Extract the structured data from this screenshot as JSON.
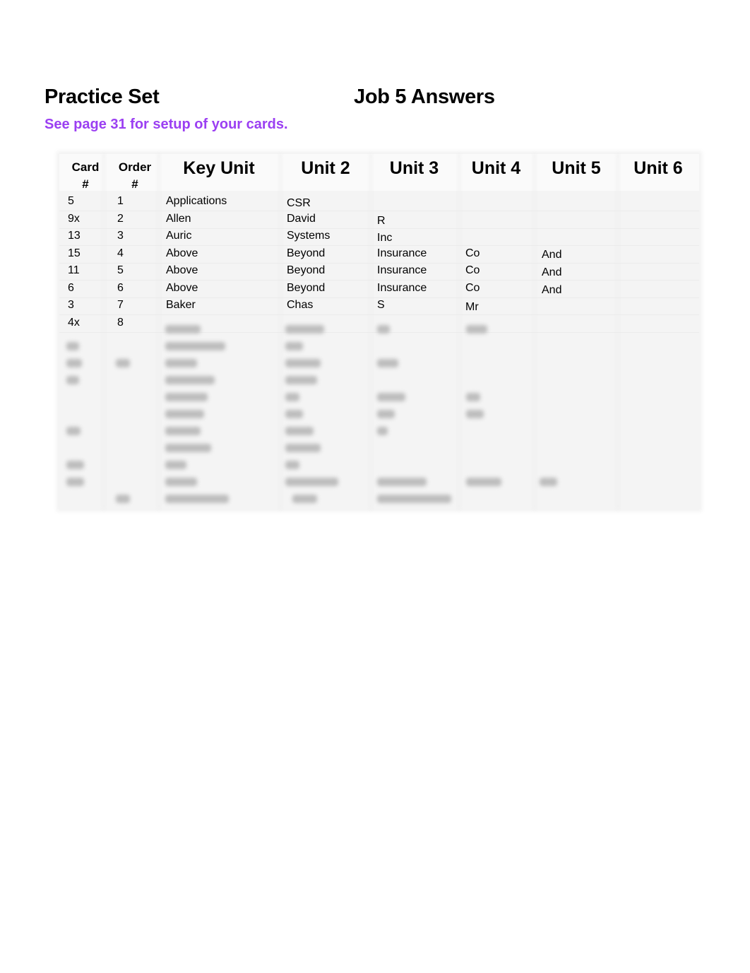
{
  "header": {
    "title": "Practice Set",
    "job_title": "Job 5 Answers",
    "subtitle": "See page 31 for setup of your cards.",
    "subtitle_color": "#9b3ff2"
  },
  "table": {
    "columns": [
      {
        "line1": "Card",
        "line2": "#"
      },
      {
        "line1": "Order",
        "line2": "#"
      },
      {
        "line1": "Key Unit"
      },
      {
        "line1": "Unit 2"
      },
      {
        "line1": "Unit 3"
      },
      {
        "line1": "Unit 4"
      },
      {
        "line1": "Unit 5"
      },
      {
        "line1": "Unit 6"
      }
    ],
    "rows": [
      [
        "5",
        "1",
        "Applications",
        "CSR",
        "",
        "",
        "",
        ""
      ],
      [
        "9x",
        "2",
        "Allen",
        "David",
        "R",
        "",
        "",
        ""
      ],
      [
        "13",
        "3",
        "Auric",
        "Systems",
        "Inc",
        "",
        "",
        ""
      ],
      [
        "15",
        "4",
        "Above",
        "Beyond",
        "Insurance",
        "Co",
        "And",
        ""
      ],
      [
        "11",
        "5",
        "Above",
        "Beyond",
        "Insurance",
        "Co",
        "And",
        ""
      ],
      [
        "6",
        "6",
        "Above",
        "Beyond",
        "Insurance",
        "Co",
        "And",
        ""
      ],
      [
        "3",
        "7",
        "Baker",
        "Chas",
        "S",
        "Mr",
        "",
        ""
      ],
      [
        "4x",
        "8",
        "",
        "",
        "",
        "",
        "",
        ""
      ]
    ],
    "blurred_rows_note": "remaining rows obscured"
  }
}
